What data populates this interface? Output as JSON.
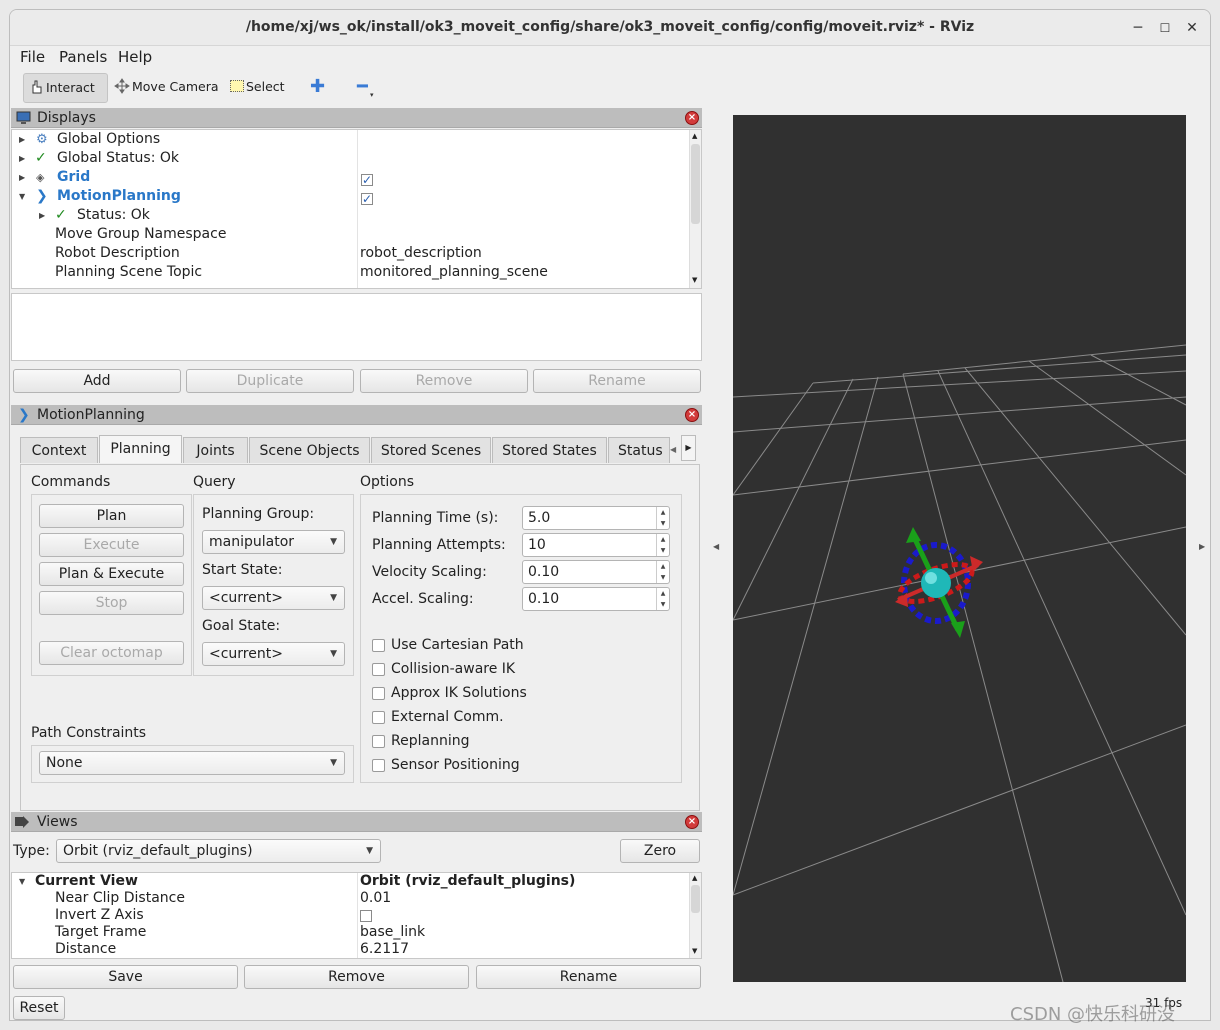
{
  "window": {
    "title": "/home/xj/ws_ok/install/ok3_moveit_config/share/ok3_moveit_config/config/moveit.rviz* - RViz"
  },
  "menu": [
    "File",
    "Panels",
    "Help"
  ],
  "toolbar": {
    "interact": "Interact",
    "move_camera": "Move Camera",
    "select": "Select"
  },
  "displays": {
    "title": "Displays",
    "rows": [
      {
        "label": "Global Options",
        "value": ""
      },
      {
        "label": "Global Status: Ok",
        "value": ""
      },
      {
        "label": "Grid",
        "value": ""
      },
      {
        "label": "MotionPlanning",
        "value": ""
      },
      {
        "label": "Status: Ok",
        "value": ""
      },
      {
        "label": "Move Group Namespace",
        "value": ""
      },
      {
        "label": "Robot Description",
        "value": "robot_description"
      },
      {
        "label": "Planning Scene Topic",
        "value": "monitored_planning_scene"
      }
    ],
    "buttons": {
      "add": "Add",
      "duplicate": "Duplicate",
      "remove": "Remove",
      "rename": "Rename"
    }
  },
  "motion_planning": {
    "title": "MotionPlanning",
    "tabs": [
      "Context",
      "Planning",
      "Joints",
      "Scene Objects",
      "Stored Scenes",
      "Stored States",
      "Status"
    ],
    "commands": {
      "title": "Commands",
      "plan": "Plan",
      "execute": "Execute",
      "plan_execute": "Plan & Execute",
      "stop": "Stop",
      "clear_octomap": "Clear octomap"
    },
    "query": {
      "title": "Query",
      "planning_group_label": "Planning Group:",
      "planning_group": "manipulator",
      "start_state_label": "Start State:",
      "start_state": "<current>",
      "goal_state_label": "Goal State:",
      "goal_state": "<current>"
    },
    "options": {
      "title": "Options",
      "planning_time_label": "Planning Time (s):",
      "planning_time": "5.0",
      "planning_attempts_label": "Planning Attempts:",
      "planning_attempts": "10",
      "velocity_scaling_label": "Velocity Scaling:",
      "velocity_scaling": "0.10",
      "accel_scaling_label": "Accel. Scaling:",
      "accel_scaling": "0.10",
      "checkboxes": [
        "Use Cartesian Path",
        "Collision-aware IK",
        "Approx IK Solutions",
        "External Comm.",
        "Replanning",
        "Sensor Positioning"
      ]
    },
    "path_constraints": {
      "label": "Path Constraints",
      "value": "None"
    }
  },
  "views": {
    "title": "Views",
    "type_label": "Type:",
    "type_value": "Orbit (rviz_default_plugins)",
    "zero": "Zero",
    "header_left": "Current View",
    "header_right": "Orbit (rviz_default_plugins)",
    "rows": [
      {
        "label": "Near Clip Distance",
        "value": "0.01"
      },
      {
        "label": "Invert Z Axis",
        "value": ""
      },
      {
        "label": "Target Frame",
        "value": "base_link"
      },
      {
        "label": "Distance",
        "value": "6.2117"
      }
    ],
    "buttons": {
      "save": "Save",
      "remove": "Remove",
      "rename": "Rename"
    }
  },
  "reset": "Reset",
  "fps": "31 fps",
  "watermark": "CSDN @快乐科研没",
  "colors": {
    "viewport_bg": "#303030",
    "grid_line": "#8a8a8a",
    "link_blue": "#2a78c8",
    "panel_header": "#bdbdbd"
  }
}
